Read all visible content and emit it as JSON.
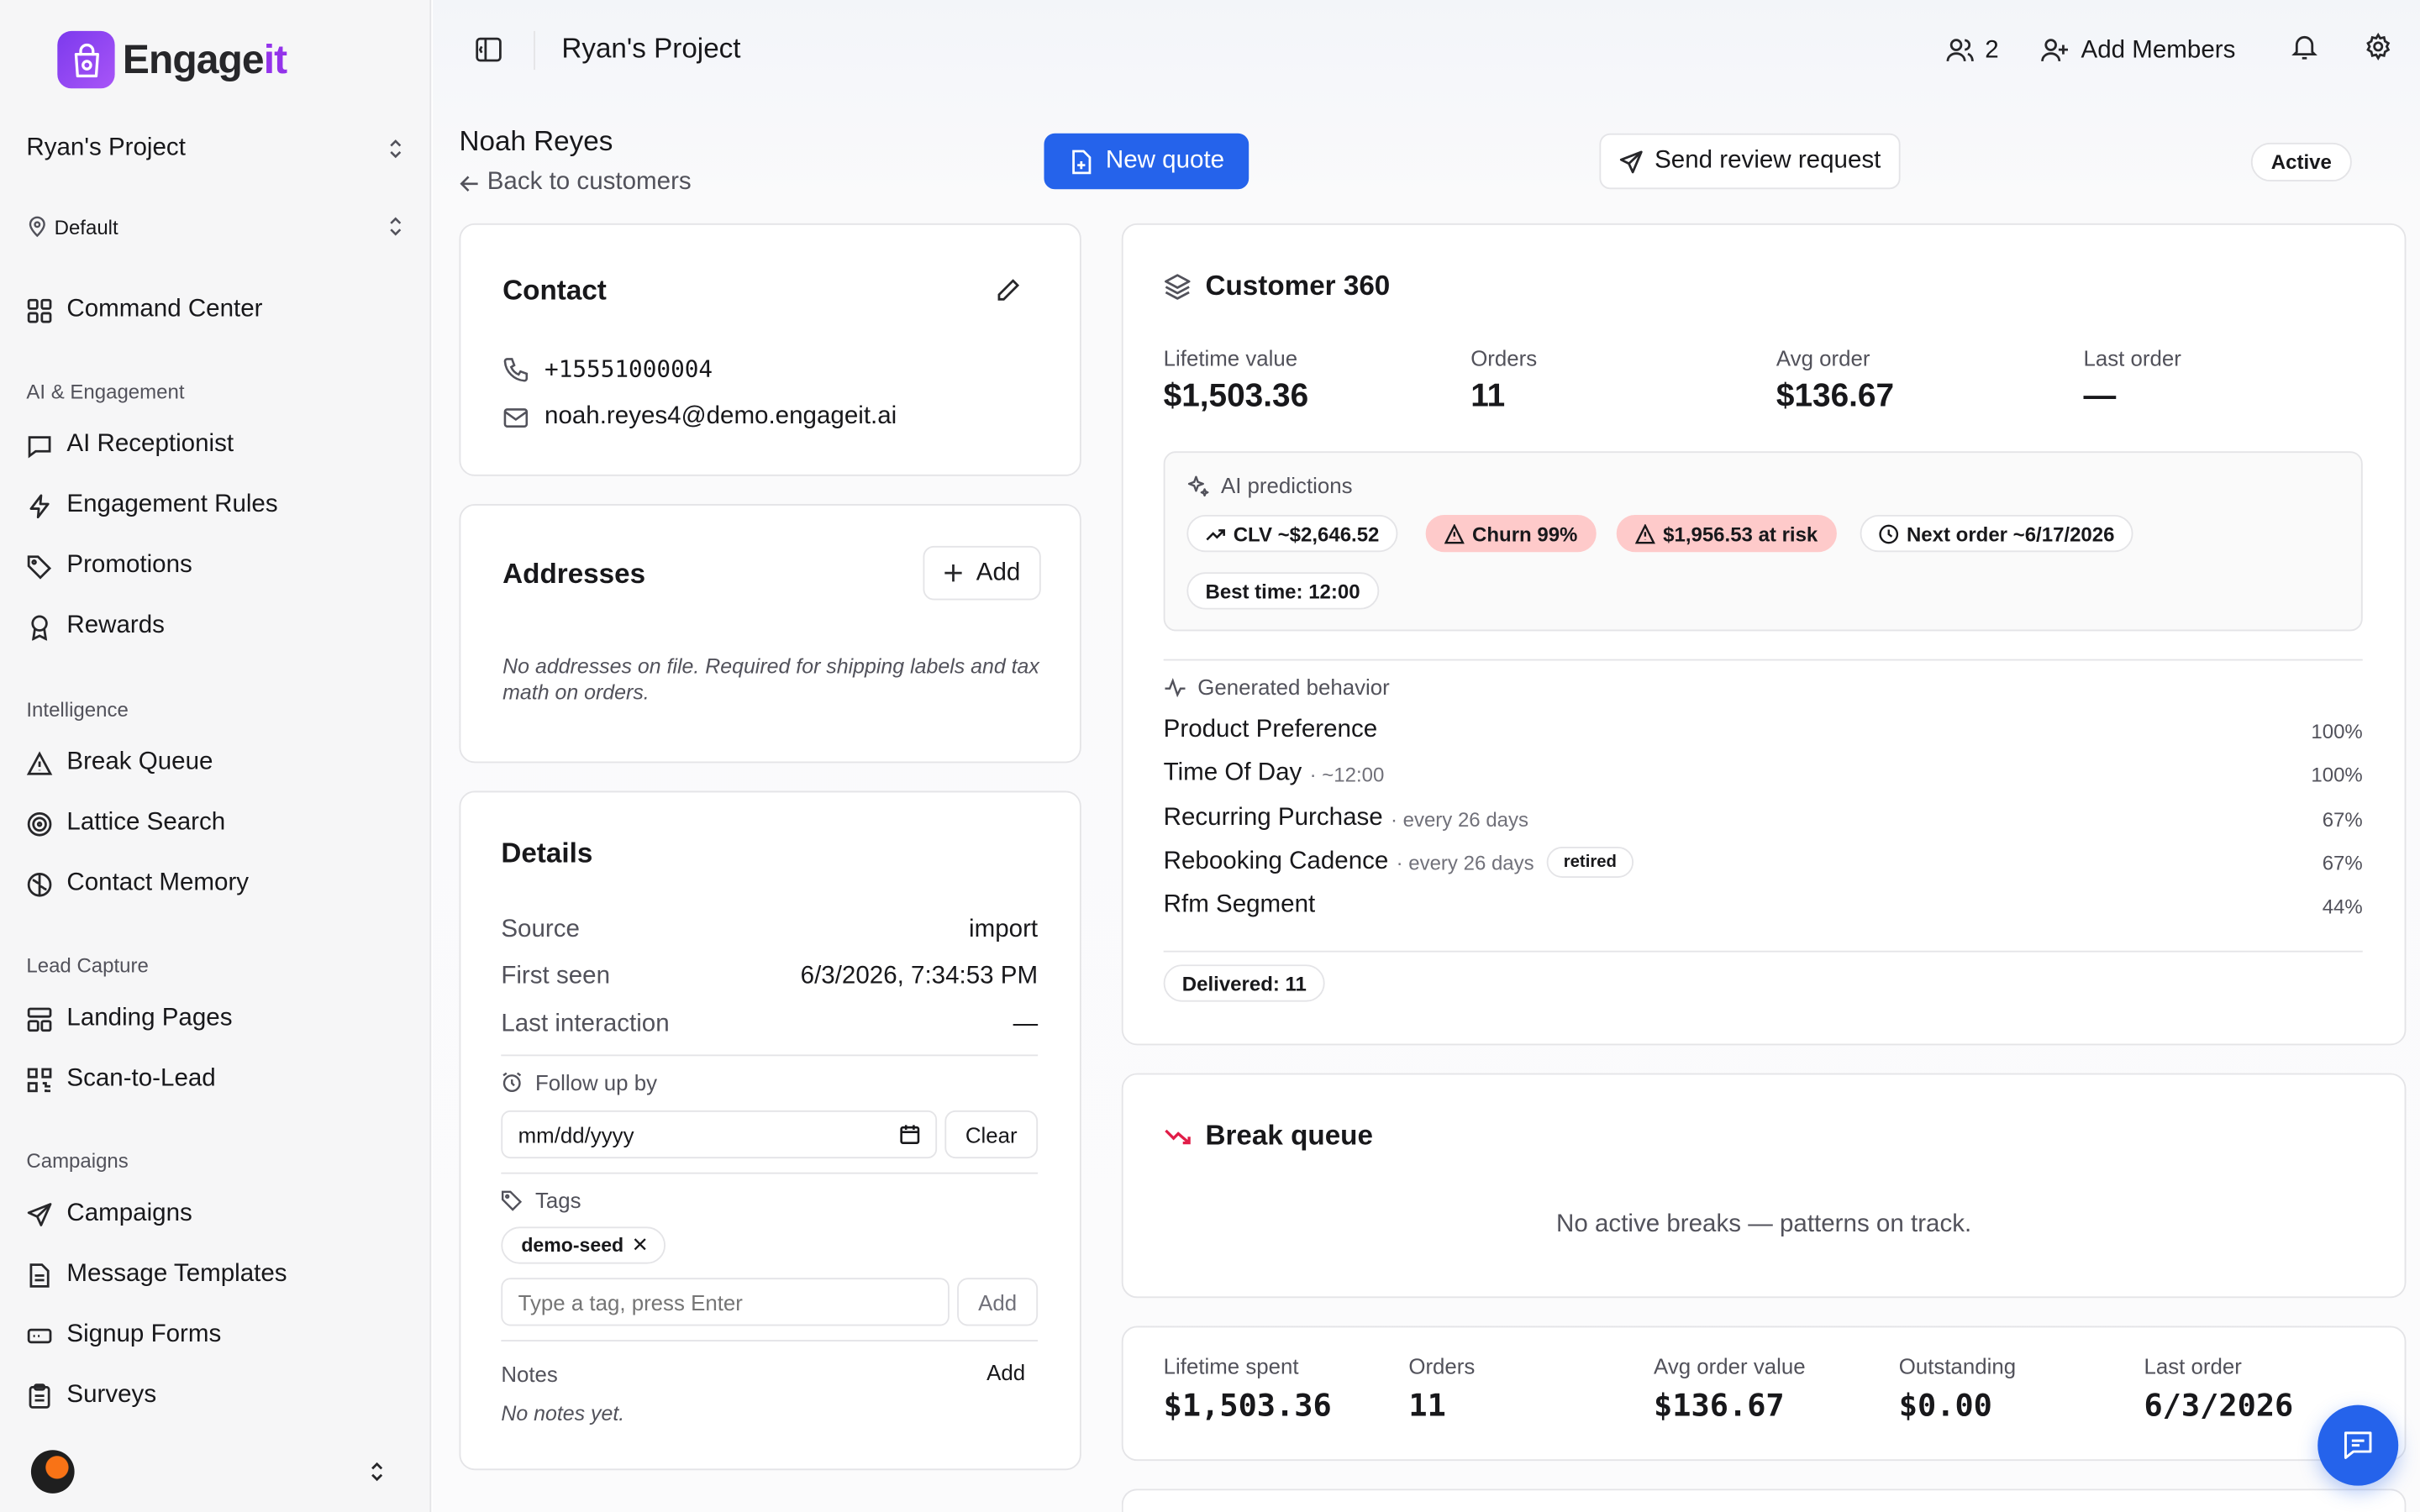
{
  "brand": {
    "name_prefix": "Engage",
    "name_suffix": "it",
    "accent": "#9333ea"
  },
  "sidebar": {
    "project": "Ryan's Project",
    "location": "Default",
    "top_item": "Command Center",
    "sections": [
      {
        "title": "AI & Engagement",
        "items": [
          "AI Receptionist",
          "Engagement Rules",
          "Promotions",
          "Rewards"
        ]
      },
      {
        "title": "Intelligence",
        "items": [
          "Break Queue",
          "Lattice Search",
          "Contact Memory"
        ]
      },
      {
        "title": "Lead Capture",
        "items": [
          "Landing Pages",
          "Scan-to-Lead"
        ]
      },
      {
        "title": "Campaigns",
        "items": [
          "Campaigns",
          "Message Templates",
          "Signup Forms",
          "Surveys"
        ]
      }
    ]
  },
  "topbar": {
    "title": "Ryan's Project",
    "members_count": "2",
    "add_members": "Add Members"
  },
  "customer": {
    "name": "Noah Reyes",
    "back": "Back to customers",
    "new_quote": "New quote",
    "send_review": "Send review request",
    "status": "Active"
  },
  "contact": {
    "title": "Contact",
    "phone": "+15551000004",
    "email": "noah.reyes4@demo.engageit.ai"
  },
  "addresses": {
    "title": "Addresses",
    "add": "Add",
    "empty": "No addresses on file. Required for shipping labels and tax math on orders."
  },
  "details": {
    "title": "Details",
    "rows": [
      {
        "label": "Source",
        "value": "import"
      },
      {
        "label": "First seen",
        "value": "6/3/2026, 7:34:53 PM"
      },
      {
        "label": "Last interaction",
        "value": "—"
      }
    ],
    "follow_up_label": "Follow up by",
    "date_placeholder": "mm/dd/yyyy",
    "clear": "Clear",
    "tags_label": "Tags",
    "tags": [
      "demo-seed"
    ],
    "tag_placeholder": "Type a tag, press Enter",
    "tag_add": "Add",
    "notes_label": "Notes",
    "notes_add": "Add",
    "notes_empty": "No notes yet."
  },
  "c360": {
    "title": "Customer 360",
    "stats": [
      {
        "label": "Lifetime value",
        "value": "$1,503.36"
      },
      {
        "label": "Orders",
        "value": "11"
      },
      {
        "label": "Avg order",
        "value": "$136.67"
      },
      {
        "label": "Last order",
        "value": "—"
      }
    ],
    "predictions_title": "AI predictions",
    "predictions": {
      "clv": "CLV ~$2,646.52",
      "churn": "Churn 99%",
      "at_risk": "$1,956.53 at risk",
      "next_order": "Next order ~6/17/2026",
      "best_time": "Best time: 12:00"
    },
    "behavior_title": "Generated behavior",
    "behaviors": [
      {
        "name": "Product Preference",
        "detail": "",
        "badge": "",
        "pct": "100%"
      },
      {
        "name": "Time Of Day",
        "detail": "· ~12:00",
        "badge": "",
        "pct": "100%"
      },
      {
        "name": "Recurring Purchase",
        "detail": "· every 26 days",
        "badge": "",
        "pct": "67%"
      },
      {
        "name": "Rebooking Cadence",
        "detail": "· every 26 days",
        "badge": "retired",
        "pct": "67%"
      },
      {
        "name": "Rfm Segment",
        "detail": "",
        "badge": "",
        "pct": "44%"
      }
    ],
    "delivered": "Delivered: 11"
  },
  "break_queue": {
    "title": "Break queue",
    "empty": "No active breaks — patterns on track."
  },
  "summary": [
    {
      "label": "Lifetime spent",
      "value": "$1,503.36"
    },
    {
      "label": "Orders",
      "value": "11"
    },
    {
      "label": "Avg order value",
      "value": "$136.67"
    },
    {
      "label": "Outstanding",
      "value": "$0.00"
    },
    {
      "label": "Last order",
      "value": "6/3/2026"
    }
  ]
}
